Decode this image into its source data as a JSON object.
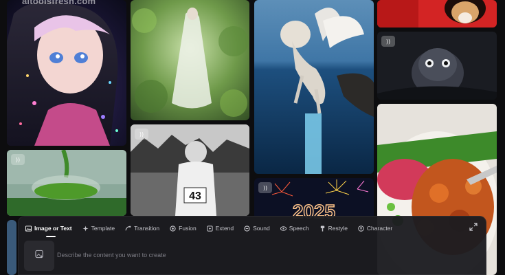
{
  "watermark": "aitoolsfresh.com",
  "gallery": {
    "tiles": [
      {
        "name": "anime-girl",
        "sound_icon": "sound-wave-icon"
      },
      {
        "name": "white-dress-figure"
      },
      {
        "name": "winged-lion-pegasus"
      },
      {
        "name": "fox-red-background"
      },
      {
        "name": "owl-dark",
        "sound_icon": "sound-wave-icon"
      },
      {
        "name": "food-bowl"
      },
      {
        "name": "matcha-pour",
        "sound_icon": "sound-wave-icon"
      },
      {
        "name": "runner-43",
        "sound_icon": "sound-wave-icon",
        "bib": "43"
      },
      {
        "name": "fireworks-2025",
        "sound_icon": "sound-wave-icon",
        "year": "2025"
      }
    ]
  },
  "composer": {
    "tabs": [
      {
        "label": "Image or Text",
        "icon": "image-icon",
        "active": true
      },
      {
        "label": "Template",
        "icon": "sparkle-icon"
      },
      {
        "label": "Transition",
        "icon": "transition-icon"
      },
      {
        "label": "Fusion",
        "icon": "fusion-icon"
      },
      {
        "label": "Extend",
        "icon": "extend-icon"
      },
      {
        "label": "Sound",
        "icon": "sound-icon"
      },
      {
        "label": "Speech",
        "icon": "speech-icon"
      },
      {
        "label": "Restyle",
        "icon": "brush-icon"
      },
      {
        "label": "Character",
        "icon": "character-icon"
      }
    ],
    "prompt_placeholder": "Describe the content you want to create",
    "prompt_value": "",
    "upload_icon": "image-upload-icon",
    "expand_icon": "expand-icon"
  }
}
